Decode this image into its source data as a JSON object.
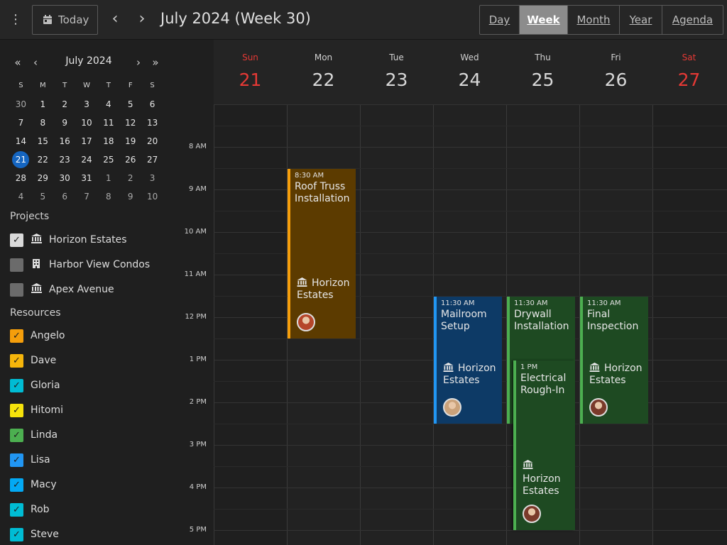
{
  "toolbar": {
    "menu_icon": "more-vertical-icon",
    "today_label": "Today",
    "prev_icon": "chevron-left-icon",
    "next_icon": "chevron-right-icon",
    "title": "July 2024 (Week 30)",
    "views": [
      "Day",
      "Week",
      "Month",
      "Year",
      "Agenda"
    ],
    "active_view": "Week"
  },
  "mini_calendar": {
    "title": "July 2024",
    "dow": [
      "S",
      "M",
      "T",
      "W",
      "T",
      "F",
      "S"
    ],
    "weeks": [
      [
        "30",
        "1",
        "2",
        "3",
        "4",
        "5",
        "6"
      ],
      [
        "7",
        "8",
        "9",
        "10",
        "11",
        "12",
        "13"
      ],
      [
        "14",
        "15",
        "16",
        "17",
        "18",
        "19",
        "20"
      ],
      [
        "21",
        "22",
        "23",
        "24",
        "25",
        "26",
        "27"
      ],
      [
        "28",
        "29",
        "30",
        "31",
        "1",
        "2",
        "3"
      ],
      [
        "4",
        "5",
        "6",
        "7",
        "8",
        "9",
        "10"
      ]
    ],
    "selected": "21"
  },
  "projects": {
    "title": "Projects",
    "items": [
      {
        "label": "Horizon Estates",
        "checked": true,
        "color": "#d9d9d9"
      },
      {
        "label": "Harbor View Condos",
        "checked": false,
        "color": "#6b6b6b"
      },
      {
        "label": "Apex Avenue",
        "checked": false,
        "color": "#6b6b6b"
      }
    ]
  },
  "resources": {
    "title": "Resources",
    "items": [
      {
        "label": "Angelo",
        "color": "#f59e0b"
      },
      {
        "label": "Dave",
        "color": "#f5b50b"
      },
      {
        "label": "Gloria",
        "color": "#00bcd4"
      },
      {
        "label": "Hitomi",
        "color": "#f5e20b"
      },
      {
        "label": "Linda",
        "color": "#4caf50"
      },
      {
        "label": "Lisa",
        "color": "#2196f3"
      },
      {
        "label": "Macy",
        "color": "#03a9f4"
      },
      {
        "label": "Rob",
        "color": "#00bcd4"
      },
      {
        "label": "Steve",
        "color": "#00bcd4"
      }
    ]
  },
  "week": {
    "days": [
      {
        "dow": "Sun",
        "num": "21",
        "weekend": true
      },
      {
        "dow": "Mon",
        "num": "22",
        "weekend": false
      },
      {
        "dow": "Tue",
        "num": "23",
        "weekend": false
      },
      {
        "dow": "Wed",
        "num": "24",
        "weekend": false
      },
      {
        "dow": "Thu",
        "num": "25",
        "weekend": false
      },
      {
        "dow": "Fri",
        "num": "26",
        "weekend": false
      },
      {
        "dow": "Sat",
        "num": "27",
        "weekend": true
      }
    ],
    "hours": [
      "8 AM",
      "9 AM",
      "10 AM",
      "11 AM",
      "12 PM",
      "1 PM",
      "2 PM",
      "3 PM",
      "4 PM",
      "5 PM"
    ]
  },
  "events": [
    {
      "day": 1,
      "time": "8:30 AM",
      "start": 8.5,
      "end": 12.5,
      "title": "Roof Truss Installation",
      "project": "Horizon Estates",
      "color": "#5c3b00",
      "border": "#f59e0b",
      "avatar_color": "#b5462a"
    },
    {
      "day": 3,
      "time": "11:30 AM",
      "start": 11.5,
      "end": 14.5,
      "title": "Mailroom Setup",
      "project": "Horizon Estates",
      "color": "#0d3a66",
      "border": "#2196f3",
      "avatar_color": "#caa27a"
    },
    {
      "day": 4,
      "time": "11:30 AM",
      "start": 11.5,
      "end": 14.5,
      "title": "Drywall Installation",
      "project": "Horizon Estates",
      "color": "#1e4a22",
      "border": "#4caf50",
      "avatar_color": "#8a5a3a"
    },
    {
      "day": 4,
      "time": "1 PM",
      "start": 13,
      "end": 17,
      "title": "Electrical Rough-In",
      "project": "Horizon Estates",
      "color": "#1e4a22",
      "border": "#4caf50",
      "avatar_color": "#7a3a2a"
    },
    {
      "day": 5,
      "time": "11:30 AM",
      "start": 11.5,
      "end": 14.5,
      "title": "Final Inspection",
      "project": "Horizon Estates",
      "color": "#1e4a22",
      "border": "#4caf50",
      "avatar_color": "#7a3a2a"
    }
  ],
  "colors": {
    "accent": "#1565c0",
    "weekend": "#e53935"
  }
}
